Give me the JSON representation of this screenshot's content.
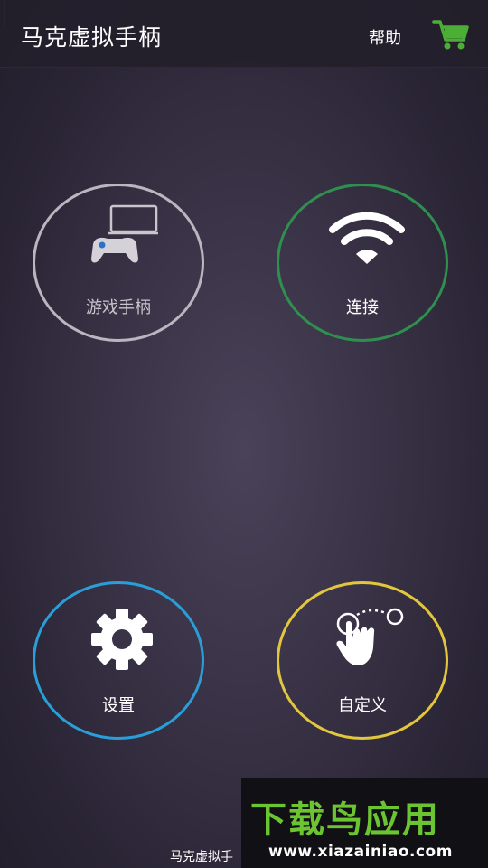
{
  "app_bar": {
    "title": "马克虚拟手柄",
    "help_label": "帮助",
    "cart_icon": "shopping-cart-icon",
    "cart_color": "#4caf35"
  },
  "buttons": {
    "gamepad": {
      "label": "游戏手柄",
      "icon": "gamepad-laptop-icon",
      "ring_color": "#b9b6bf"
    },
    "connect": {
      "label": "连接",
      "icon": "wifi-icon",
      "ring_color": "#2f8f4f"
    },
    "settings": {
      "label": "设置",
      "icon": "gear-icon",
      "ring_color": "#2a9ed8"
    },
    "custom": {
      "label": "自定义",
      "icon": "touch-gesture-icon",
      "ring_color": "#e2c63d"
    }
  },
  "footer": {
    "truncated_title": "马克虚拟手"
  },
  "watermark": {
    "logo_text": "下载鸟应用",
    "url": "www.xiazainiao.com"
  }
}
